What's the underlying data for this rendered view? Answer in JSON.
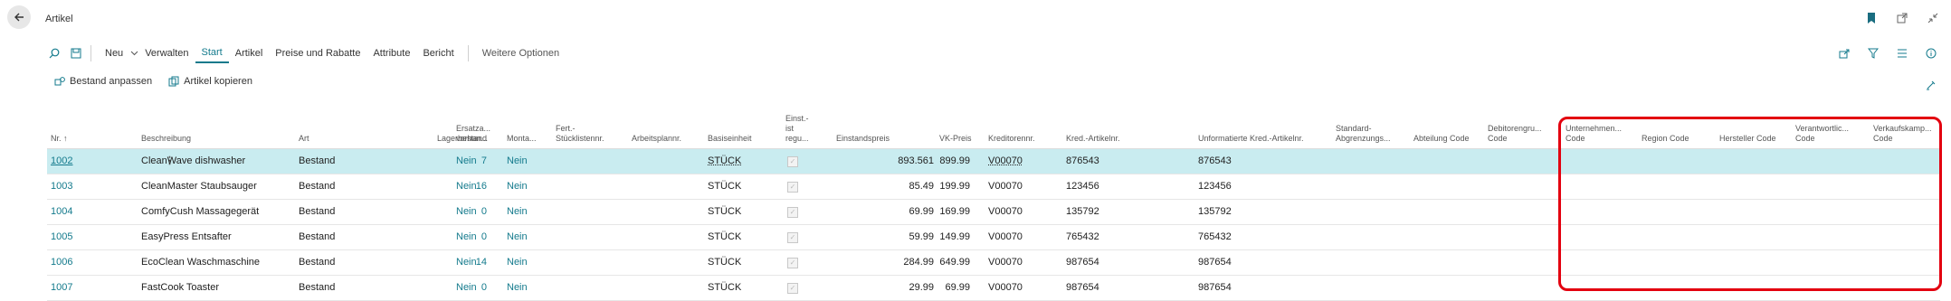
{
  "page": {
    "title": "Artikel"
  },
  "actions": {
    "neu": "Neu",
    "verwalten": "Verwalten",
    "start": "Start",
    "artikel": "Artikel",
    "preise": "Preise und Rabatte",
    "attribute": "Attribute",
    "bericht": "Bericht",
    "weitere": "Weitere Optionen"
  },
  "subactions": {
    "bestand": "Bestand anpassen",
    "kopieren": "Artikel kopieren"
  },
  "columns": {
    "nr": "Nr. ↑",
    "beschreibung": "Beschreibung",
    "art": "Art",
    "lagerbestand": "Lagerbestand",
    "ersatz": [
      "Ersatza...",
      "vorhan..."
    ],
    "monta": "Monta...",
    "fert": [
      "Fert.-",
      "Stücklistennr."
    ],
    "arbeitsplan": "Arbeitsplannr.",
    "basiseinheit": "Basiseinheit",
    "einst": [
      "Einst.-",
      "ist",
      "regu..."
    ],
    "einstandspreis": "Einstandspreis",
    "vkpreis": "VK-Preis",
    "kreditor": "Kreditorennr.",
    "kredartikel": "Kred.-Artikelnr.",
    "unformatiert": "Unformatierte Kred.-Artikelnr.",
    "standard": [
      "Standard-",
      "Abgrenzungs..."
    ],
    "abteilung": "Abteilung Code",
    "debitor": [
      "Debitorengru...",
      "Code"
    ],
    "unternehmen": [
      "Unternehmen...",
      "Code"
    ],
    "region": "Region Code",
    "hersteller": "Hersteller Code",
    "verantwortlich": [
      "Verantwortlic...",
      "Code"
    ],
    "verkauf": [
      "Verkaufskamp...",
      "Code"
    ]
  },
  "rows": [
    {
      "nr": "1002",
      "beschreibung": "CleanWave dishwasher",
      "art": "Bestand",
      "lager": "7",
      "ersatz": "Nein",
      "monta": "Nein",
      "einheit": "STÜCK",
      "einstandspreis": "893.561",
      "vkpreis": "899.99",
      "kreditor": "V00070",
      "kredartikel": "876543",
      "unformatiert": "876543"
    },
    {
      "nr": "1003",
      "beschreibung": "CleanMaster Staubsauger",
      "art": "Bestand",
      "lager": "16",
      "ersatz": "Nein",
      "monta": "Nein",
      "einheit": "STÜCK",
      "einstandspreis": "85.49",
      "vkpreis": "199.99",
      "kreditor": "V00070",
      "kredartikel": "123456",
      "unformatiert": "123456"
    },
    {
      "nr": "1004",
      "beschreibung": "ComfyCush Massagegerät",
      "art": "Bestand",
      "lager": "0",
      "ersatz": "Nein",
      "monta": "Nein",
      "einheit": "STÜCK",
      "einstandspreis": "69.99",
      "vkpreis": "169.99",
      "kreditor": "V00070",
      "kredartikel": "135792",
      "unformatiert": "135792"
    },
    {
      "nr": "1005",
      "beschreibung": "EasyPress Entsafter",
      "art": "Bestand",
      "lager": "0",
      "ersatz": "Nein",
      "monta": "Nein",
      "einheit": "STÜCK",
      "einstandspreis": "59.99",
      "vkpreis": "149.99",
      "kreditor": "V00070",
      "kredartikel": "765432",
      "unformatiert": "765432"
    },
    {
      "nr": "1006",
      "beschreibung": "EcoClean Waschmaschine",
      "art": "Bestand",
      "lager": "14",
      "ersatz": "Nein",
      "monta": "Nein",
      "einheit": "STÜCK",
      "einstandspreis": "284.99",
      "vkpreis": "649.99",
      "kreditor": "V00070",
      "kredartikel": "987654",
      "unformatiert": "987654"
    },
    {
      "nr": "1007",
      "beschreibung": "FastCook Toaster",
      "art": "Bestand",
      "lager": "0",
      "ersatz": "Nein",
      "monta": "Nein",
      "einheit": "STÜCK",
      "einstandspreis": "29.99",
      "vkpreis": "69.99",
      "kreditor": "V00070",
      "kredartikel": "987654",
      "unformatiert": "987654"
    }
  ],
  "colors": {
    "accent": "#137a8c",
    "selected_row": "#c9ecf0",
    "highlight": "#e3000f"
  }
}
